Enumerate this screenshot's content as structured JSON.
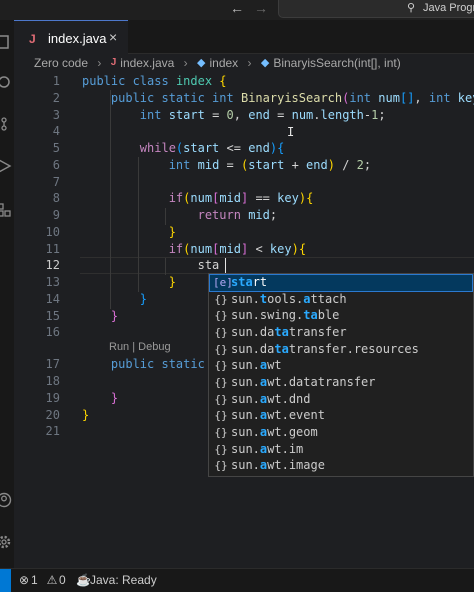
{
  "titlebar": {
    "back_icon": "arrow-left-icon",
    "forward_icon": "arrow-right-icon",
    "search_text": "Java Progra"
  },
  "tab": {
    "label": "index.java",
    "language_icon": "J",
    "close": "×"
  },
  "breadcrumb": [
    "Zero code",
    "index.java",
    "index",
    "BinaryisSearch(int[], int)"
  ],
  "line_numbers": [
    "1",
    "2",
    "3",
    "4",
    "5",
    "6",
    "7",
    "8",
    "9",
    "10",
    "11",
    "12",
    "13",
    "14",
    "15",
    "16",
    "17",
    "18",
    "19",
    "20",
    "21"
  ],
  "active_line": "12",
  "code_lens": "Run | Debug",
  "suggestions": [
    {
      "icon": "[e]",
      "text": "start",
      "kind": "variable"
    },
    {
      "icon": "{}",
      "text": "sun.tools.attach",
      "kind": "module"
    },
    {
      "icon": "{}",
      "text": "sun.swing.table",
      "kind": "module"
    },
    {
      "icon": "{}",
      "text": "sun.datatransfer",
      "kind": "module"
    },
    {
      "icon": "{}",
      "text": "sun.datatransfer.resources",
      "kind": "module"
    },
    {
      "icon": "{}",
      "text": "sun.awt",
      "kind": "module"
    },
    {
      "icon": "{}",
      "text": "sun.awt.datatransfer",
      "kind": "module"
    },
    {
      "icon": "{}",
      "text": "sun.awt.dnd",
      "kind": "module"
    },
    {
      "icon": "{}",
      "text": "sun.awt.event",
      "kind": "module"
    },
    {
      "icon": "{}",
      "text": "sun.awt.geom",
      "kind": "module"
    },
    {
      "icon": "{}",
      "text": "sun.awt.im",
      "kind": "module"
    },
    {
      "icon": "{}",
      "text": "sun.awt.image",
      "kind": "module"
    }
  ],
  "status": {
    "errors": "1",
    "warnings": "0",
    "java": "Java: Ready"
  },
  "colors": {
    "accent": "#0078d4",
    "selection": "#04395e",
    "match": "#2aaaff"
  }
}
